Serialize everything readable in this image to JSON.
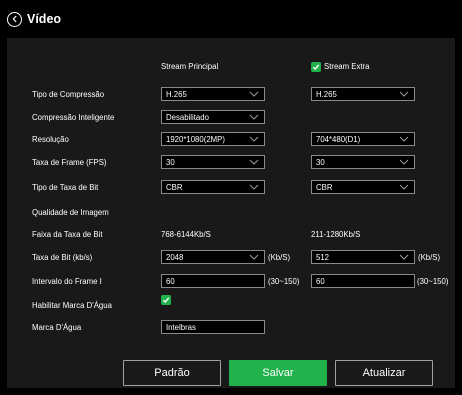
{
  "header": {
    "title": "Vídeo",
    "back_icon": "chevron-left-icon"
  },
  "columns": {
    "main": "Stream Principal",
    "extra": "Stream Extra",
    "extra_checked": true
  },
  "labels": {
    "compression": "Tipo de Compressão",
    "smart_compression": "Compressão Inteligente",
    "resolution": "Resolução",
    "frame_rate": "Taxa de Frame (FPS)",
    "bitrate_type": "Tipo de Taxa de Bit",
    "image_quality": "Qualidade de Imagem",
    "bitrate_range": "Faixa da Taxa de Bit",
    "bitrate": "Taxa de Bit (kb/s)",
    "iframe_interval": "Intervalo do Frame I",
    "watermark_enable": "Habilitar Marca D'Água",
    "watermark": "Marca D'Água"
  },
  "main": {
    "compression": "H.265",
    "smart_compression": "Desabilitado",
    "resolution": "1920*1080(2MP)",
    "frame_rate": "30",
    "bitrate_type": "CBR",
    "bitrate_range": "768-6144Kb/S",
    "bitrate": "2048",
    "bitrate_unit": "(Kb/S)",
    "iframe_interval": "60",
    "iframe_range": "(30~150)"
  },
  "extra": {
    "compression": "H.265",
    "resolution": "704*480(D1)",
    "frame_rate": "30",
    "bitrate_type": "CBR",
    "bitrate_range": "211-1280Kb/S",
    "bitrate": "512",
    "bitrate_unit": "(Kb/S)",
    "iframe_interval": "60",
    "iframe_range": "(30~150)"
  },
  "watermark": {
    "enabled": true,
    "text": "Intelbras"
  },
  "buttons": {
    "default": "Padrão",
    "save": "Salvar",
    "refresh": "Atualizar"
  },
  "colors": {
    "accent": "#21b24b",
    "panel": "#191919",
    "background": "#000000",
    "border": "#8a8a8a"
  }
}
